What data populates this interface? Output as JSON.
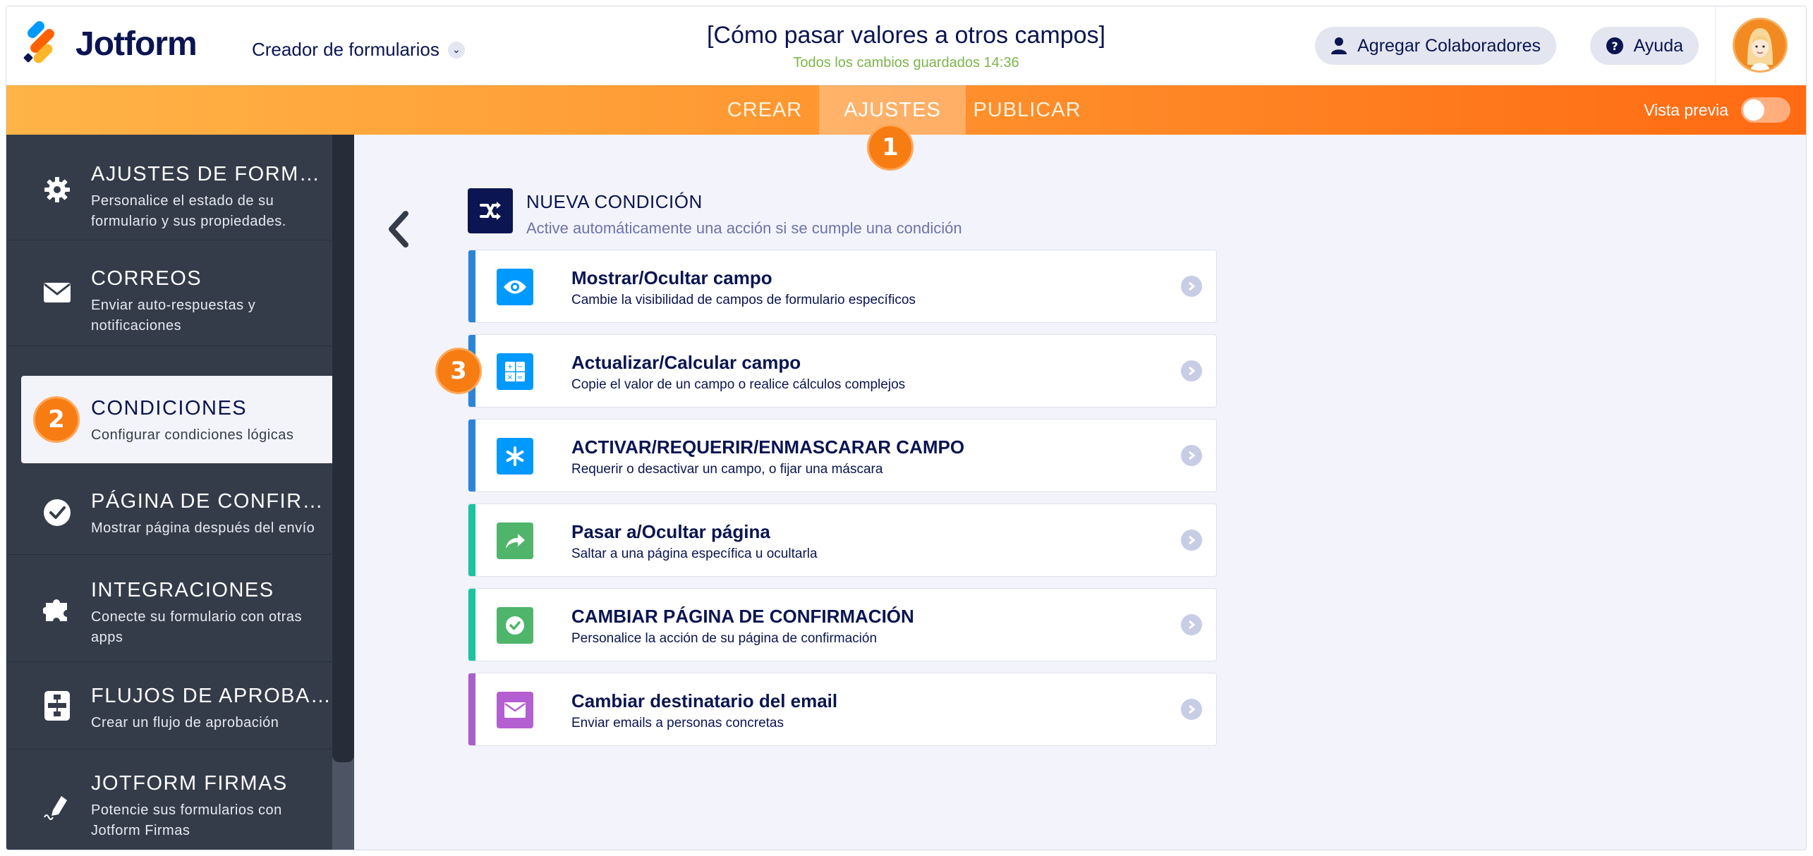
{
  "header": {
    "brand": "Jotform",
    "form_builder": "Creador de formularios",
    "form_title": "[Cómo pasar valores a otros campos]",
    "saved_status": "Todos los cambios guardados 14:36",
    "add_collaborators": "Agregar Colaboradores",
    "help": "Ayuda"
  },
  "nav": {
    "tabs": [
      "CREAR",
      "AJUSTES",
      "PUBLICAR"
    ],
    "active_tab": "AJUSTES",
    "preview_label": "Vista previa",
    "preview_on": false
  },
  "badges": [
    "1",
    "2",
    "3"
  ],
  "sidebar": {
    "items": [
      {
        "title": "AJUSTES DE FORMULA...",
        "desc": "Personalice el estado de su formulario y sus propiedades.",
        "icon": "gear-icon"
      },
      {
        "title": "CORREOS",
        "desc": "Enviar auto-respuestas y notificaciones",
        "icon": "envelope-icon"
      },
      {
        "title": "CONDICIONES",
        "desc": "Configurar condiciones lógicas",
        "icon": "conditions-icon"
      },
      {
        "title": "PÁGINA DE CONFIRMA...",
        "desc": "Mostrar página después del envío",
        "icon": "check-circle-icon"
      },
      {
        "title": "INTEGRACIONES",
        "desc": "Conecte su formulario con otras apps",
        "icon": "puzzle-icon"
      },
      {
        "title": "FLUJOS DE APROBACI...",
        "desc": "Crear un flujo de aprobación",
        "icon": "flow-icon"
      },
      {
        "title": "JOTFORM FIRMAS",
        "desc": "Potencie sus formularios con Jotform Firmas",
        "icon": "pen-icon"
      }
    ],
    "active_index": 2
  },
  "condition_header": {
    "title": "NUEVA CONDICIÓN",
    "subtitle": "Active automáticamente una acción si se cumple una condición"
  },
  "conditions": [
    {
      "title": "Mostrar/Ocultar campo",
      "desc": "Cambie la visibilidad de campos de formulario específicos",
      "color": "#0099ff",
      "bar": "#2a85d9",
      "icon": "eye-icon"
    },
    {
      "title": "Actualizar/Calcular campo",
      "desc": "Copie el valor de un campo o realice cálculos complejos",
      "color": "#0099ff",
      "bar": "#2a85d9",
      "icon": "calculator-icon"
    },
    {
      "title": "ACTIVAR/REQUERIR/ENMASCARAR CAMPO",
      "desc": "Requerir o desactivar un campo, o fijar una máscara",
      "color": "#0099ff",
      "bar": "#2a85d9",
      "icon": "asterisk-icon"
    },
    {
      "title": "Pasar a/Ocultar página",
      "desc": "Saltar a una página específica u ocultarla",
      "color": "#4fb56b",
      "bar": "#1bc4a0",
      "icon": "share-arrow-icon"
    },
    {
      "title": "CAMBIAR PÁGINA DE CONFIRMACIÓN",
      "desc": "Personalice la acción de su página de confirmación",
      "color": "#4fb56b",
      "bar": "#1bc4a0",
      "icon": "check-icon"
    },
    {
      "title": "Cambiar destinatario del email",
      "desc": "Enviar emails a personas concretas",
      "color": "#b45fd1",
      "bar": "#a95ec9",
      "icon": "envelope-icon"
    }
  ],
  "colors": {
    "brand_navy": "#0a1551",
    "accent_orange": "#f77c12",
    "sidebar_bg": "#343c4a",
    "saved_green": "#7db44a"
  }
}
